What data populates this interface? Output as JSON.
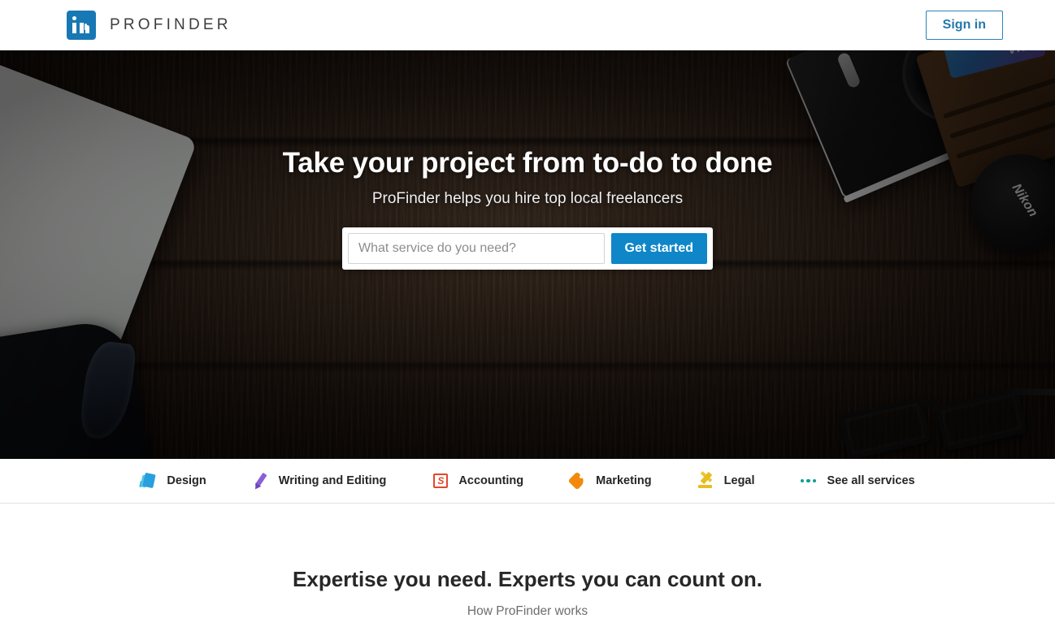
{
  "header": {
    "logo_icon": "linkedin-logo-icon",
    "brand_name": "PROFINDER",
    "signin_label": "Sign in"
  },
  "hero": {
    "title": "Take your project from to-do to done",
    "subtitle": "ProFinder helps you hire top local freelancers",
    "search_placeholder": "What service do you need?",
    "search_value": "",
    "cta_label": "Get started",
    "photo_description": "Dark wood desk with camera, wallet with Visa card, Nikon lens cap, laptop and eyeglasses",
    "visa_card_label": "VISA",
    "lens_cap_label": "Nikon"
  },
  "categories": [
    {
      "label": "Design",
      "icon": "design-cards-icon",
      "color": "#27a0dd"
    },
    {
      "label": "Writing and Editing",
      "icon": "pencil-icon",
      "color": "#8b5fd6"
    },
    {
      "label": "Accounting",
      "icon": "dollar-square-icon",
      "color": "#e3482c",
      "glyph": "S"
    },
    {
      "label": "Marketing",
      "icon": "tag-icon",
      "color": "#f2890d"
    },
    {
      "label": "Legal",
      "icon": "gavel-icon",
      "color": "#e8bd1f"
    },
    {
      "label": "See all services",
      "icon": "ellipsis-dots-icon",
      "color": "#0f9e93"
    }
  ],
  "expertise": {
    "title": "Expertise you need. Experts you can count on.",
    "subtitle": "How ProFinder works"
  },
  "colors": {
    "linkedin_blue": "#0e86c8",
    "signin_blue": "#2279ad",
    "rule_blue": "#12729e",
    "teal": "#0f9e93"
  }
}
